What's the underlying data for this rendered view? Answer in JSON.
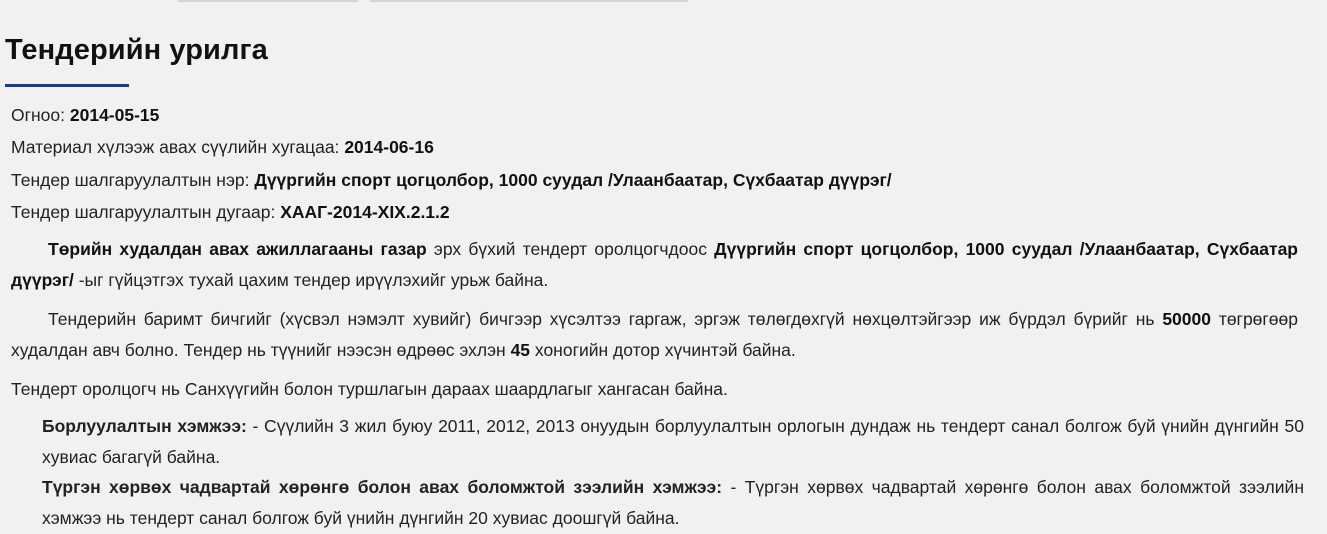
{
  "page": {
    "title": "Тендерийн урилга"
  },
  "meta": {
    "date_label": "Огноо:",
    "date_value": "2014-05-15",
    "deadline_label": "Материал хүлээж авах сүүлийн хугацаа:",
    "deadline_value": "2014-06-16",
    "name_label": "Тендер шалгаруулалтын нэр:",
    "name_value": "Дүүргийн спорт цогцолбор, 1000 суудал /Улаанбаатар, Сүхбаатар дүүрэг/",
    "number_label": "Тендер шалгаруулалтын дугаар:",
    "number_value": "ХААГ-2014-XIX.2.1.2"
  },
  "paragraph1": {
    "org": "Төрийн худалдан авах ажиллагааны газар",
    "text1": " эрх бүхий тендерт оролцогчдоос ",
    "project": "Дүүргийн спорт цогцолбор, 1000 суудал /Улаанбаатар, Сүхбаатар дүүрэг/",
    "text2": " -ыг гүйцэтгэх тухай цахим тендер ирүүлэхийг урьж байна."
  },
  "paragraph2": {
    "text1": "Тендерийн баримт бичгийг (хүсвэл нэмэлт хувийг) бичгээр хүсэлтээ гаргаж, эргэж төлөгдөхгүй нөхцөлтэйгээр иж бүрдэл бүрийг нь ",
    "fee": "50000",
    "text2": " төгрөгөөр худалдан авч болно. Тендер нь түүнийг нээсэн өдрөөс эхлэн ",
    "days": "45",
    "text3": " хоногийн дотор хүчинтэй байна."
  },
  "paragraph3": {
    "text": "Тендерт оролцогч нь Санхүүгийн болон туршлагын дараах шаардлагыг хангасан байна."
  },
  "requirements": [
    {
      "label": "Борлуулалтын хэмжээ:",
      "text": " - Сүүлийн 3 жил буюу 2011, 2012, 2013 онуудын борлуулалтын орлогын дундаж нь тендерт санал болгож буй үнийн дүнгийн 50 хувиас багагүй байна."
    },
    {
      "label": "Түргэн хөрвөх чадвартай хөрөнгө болон авах боломжтой зээлийн хэмжээ:",
      "text": " - Түргэн хөрвөх чадвартай хөрөнгө болон авах боломжтой зээлийн хэмжээ нь тендерт санал болгож буй үнийн дүнгийн 20 хувиас доошгүй байна."
    }
  ]
}
